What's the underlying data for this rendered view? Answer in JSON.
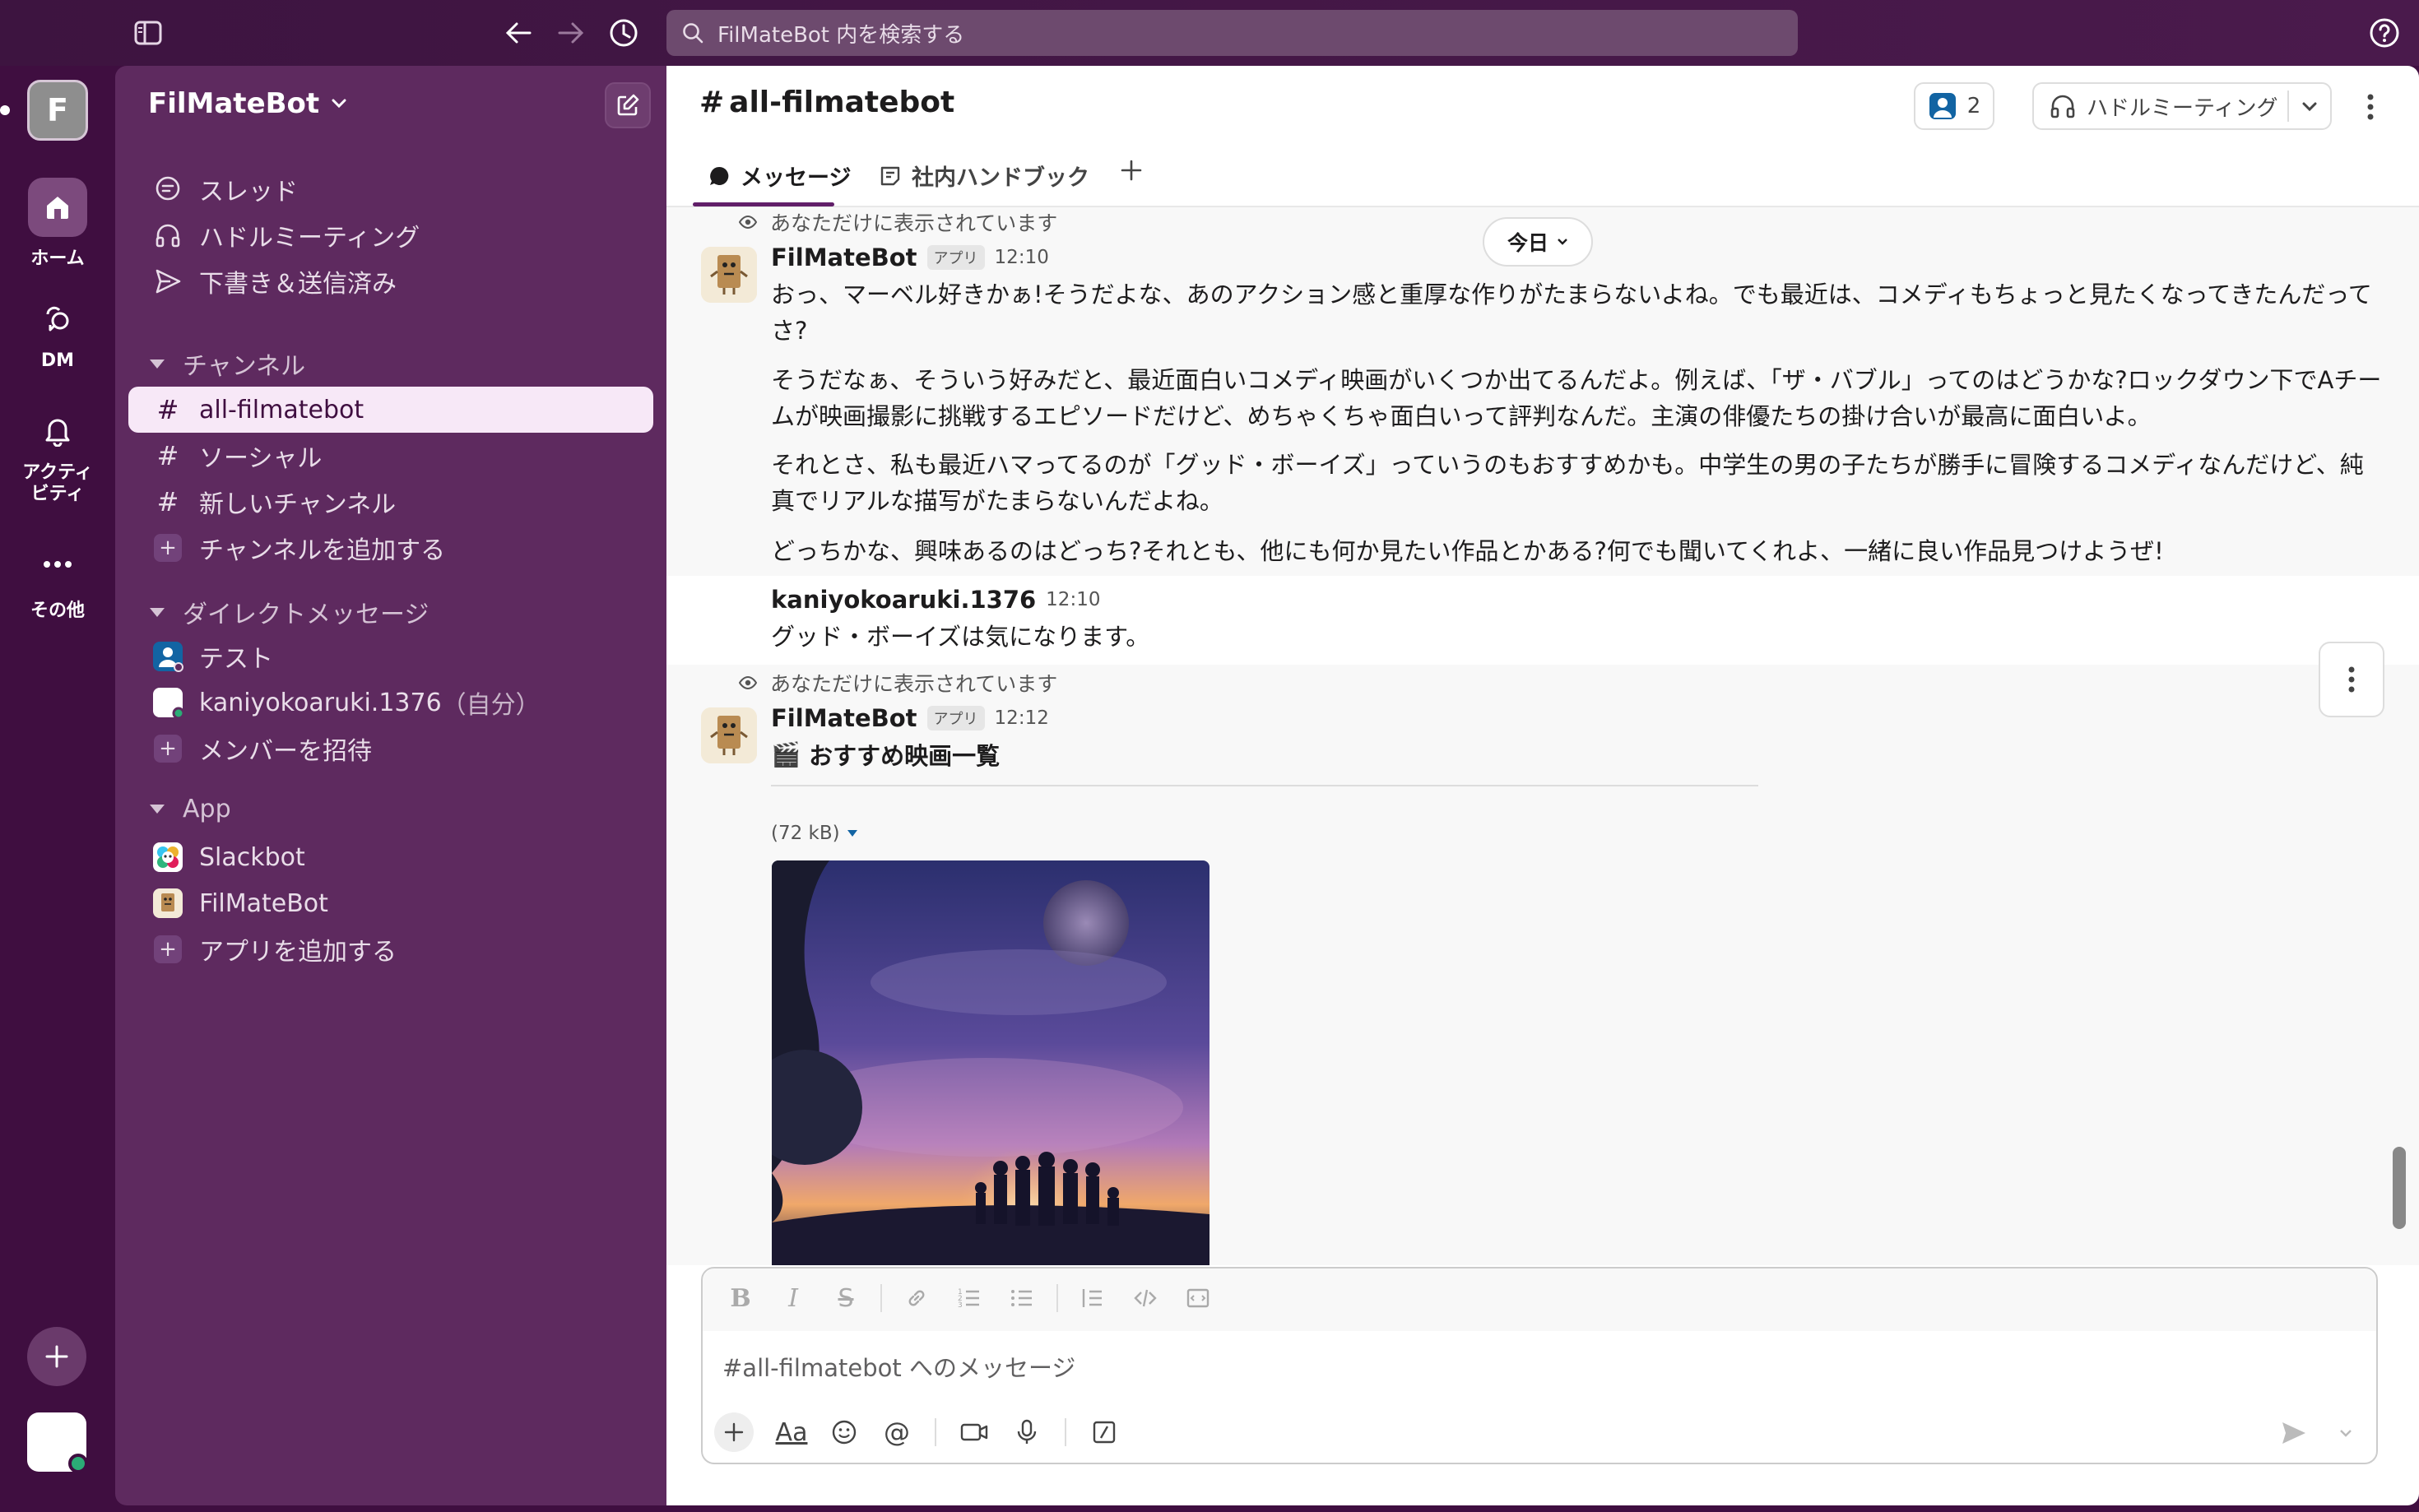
{
  "topbar": {
    "search_placeholder": "FilMateBot 内を検索する",
    "icons": [
      "sidebar-toggle-icon",
      "back-arrow-icon",
      "forward-arrow-icon",
      "history-icon",
      "help-icon"
    ]
  },
  "rail": {
    "workspace_initial": "F",
    "items": [
      {
        "label": "ホーム",
        "icon": "home-icon"
      },
      {
        "label": "DM",
        "icon": "dm-icon"
      },
      {
        "label": "アクティビティ",
        "icon": "bell-icon"
      },
      {
        "label": "その他",
        "icon": "more-icon"
      }
    ]
  },
  "sidebar": {
    "workspace_name": "FilMateBot",
    "nav": [
      {
        "label": "スレッド",
        "icon": "threads-icon"
      },
      {
        "label": "ハドルミーティング",
        "icon": "headphones-icon"
      },
      {
        "label": "下書き＆送信済み",
        "icon": "send-icon"
      }
    ],
    "channels_header": "チャンネル",
    "channels": [
      {
        "label": "all-filmatebot",
        "active": true
      },
      {
        "label": "ソーシャル",
        "active": false
      },
      {
        "label": "新しいチャンネル",
        "active": false
      }
    ],
    "add_channel": "チャンネルを追加する",
    "dm_header": "ダイレクトメッセージ",
    "dms": [
      {
        "label": "テスト"
      },
      {
        "label": "kaniyokoaruki.1376",
        "suffix": "（自分）"
      }
    ],
    "invite": "メンバーを招待",
    "app_header": "App",
    "apps": [
      {
        "label": "Slackbot"
      },
      {
        "label": "FilMateBot"
      }
    ],
    "add_app": "アプリを追加する"
  },
  "channel": {
    "name": "all-filmatebot",
    "hash": "#",
    "member_count": "2",
    "huddle_label": "ハドルミーティング",
    "tabs": [
      {
        "label": "メッセージ",
        "icon": "message-icon",
        "active": true
      },
      {
        "label": "社内ハンドブック",
        "icon": "canvas-icon",
        "active": false
      }
    ],
    "date_pill": "今日"
  },
  "messages": [
    {
      "ephemeral_note": "あなただけに表示されています",
      "sender": "FilMateBot",
      "badge": "アプリ",
      "time": "12:10",
      "paragraphs": [
        "おっ、マーベル好きかぁ!そうだよな、あのアクション感と重厚な作りがたまらないよね。でも最近は、コメディもちょっと見たくなってきたんだってさ?",
        "そうだなぁ、そういう好みだと、最近面白いコメディ映画がいくつか出てるんだよ。例えば、「ザ・バブル」ってのはどうかな?ロックダウン下でAチームが映画撮影に挑戦するエピソードだけど、めちゃくちゃ面白いって評判なんだ。主演の俳優たちの掛け合いが最高に面白いよ。",
        "それとさ、私も最近ハマってるのが「グッド・ボーイズ」っていうのもおすすめかも。中学生の男の子たちが勝手に冒険するコメディなんだけど、純真でリアルな描写がたまらないんだよね。",
        "どっちかな、興味あるのはどっち?それとも、他にも何か見たい作品とかある?何でも聞いてくれよ、一緒に良い作品見つけようぜ!"
      ]
    },
    {
      "sender": "kaniyokoaruki.1376",
      "time": "12:10",
      "paragraphs": [
        "グッド・ボーイズは気になります。"
      ]
    },
    {
      "ephemeral_note": "あなただけに表示されています",
      "sender": "FilMateBot",
      "badge": "アプリ",
      "time": "12:12",
      "heading_emoji": "🎬",
      "heading": "おすすめ映画一覧",
      "file_size": "(72 kB)"
    }
  ],
  "composer": {
    "placeholder": "#all-filmatebot へのメッセージ",
    "format_icons": [
      "bold-icon",
      "italic-icon",
      "strikethrough-icon",
      "link-icon",
      "ordered-list-icon",
      "bullet-list-icon",
      "blockquote-icon",
      "code-icon",
      "code-block-icon"
    ],
    "action_icons": [
      "plus-icon",
      "text-format-icon",
      "emoji-icon",
      "mention-icon",
      "video-icon",
      "microphone-icon",
      "slash-command-icon"
    ]
  }
}
